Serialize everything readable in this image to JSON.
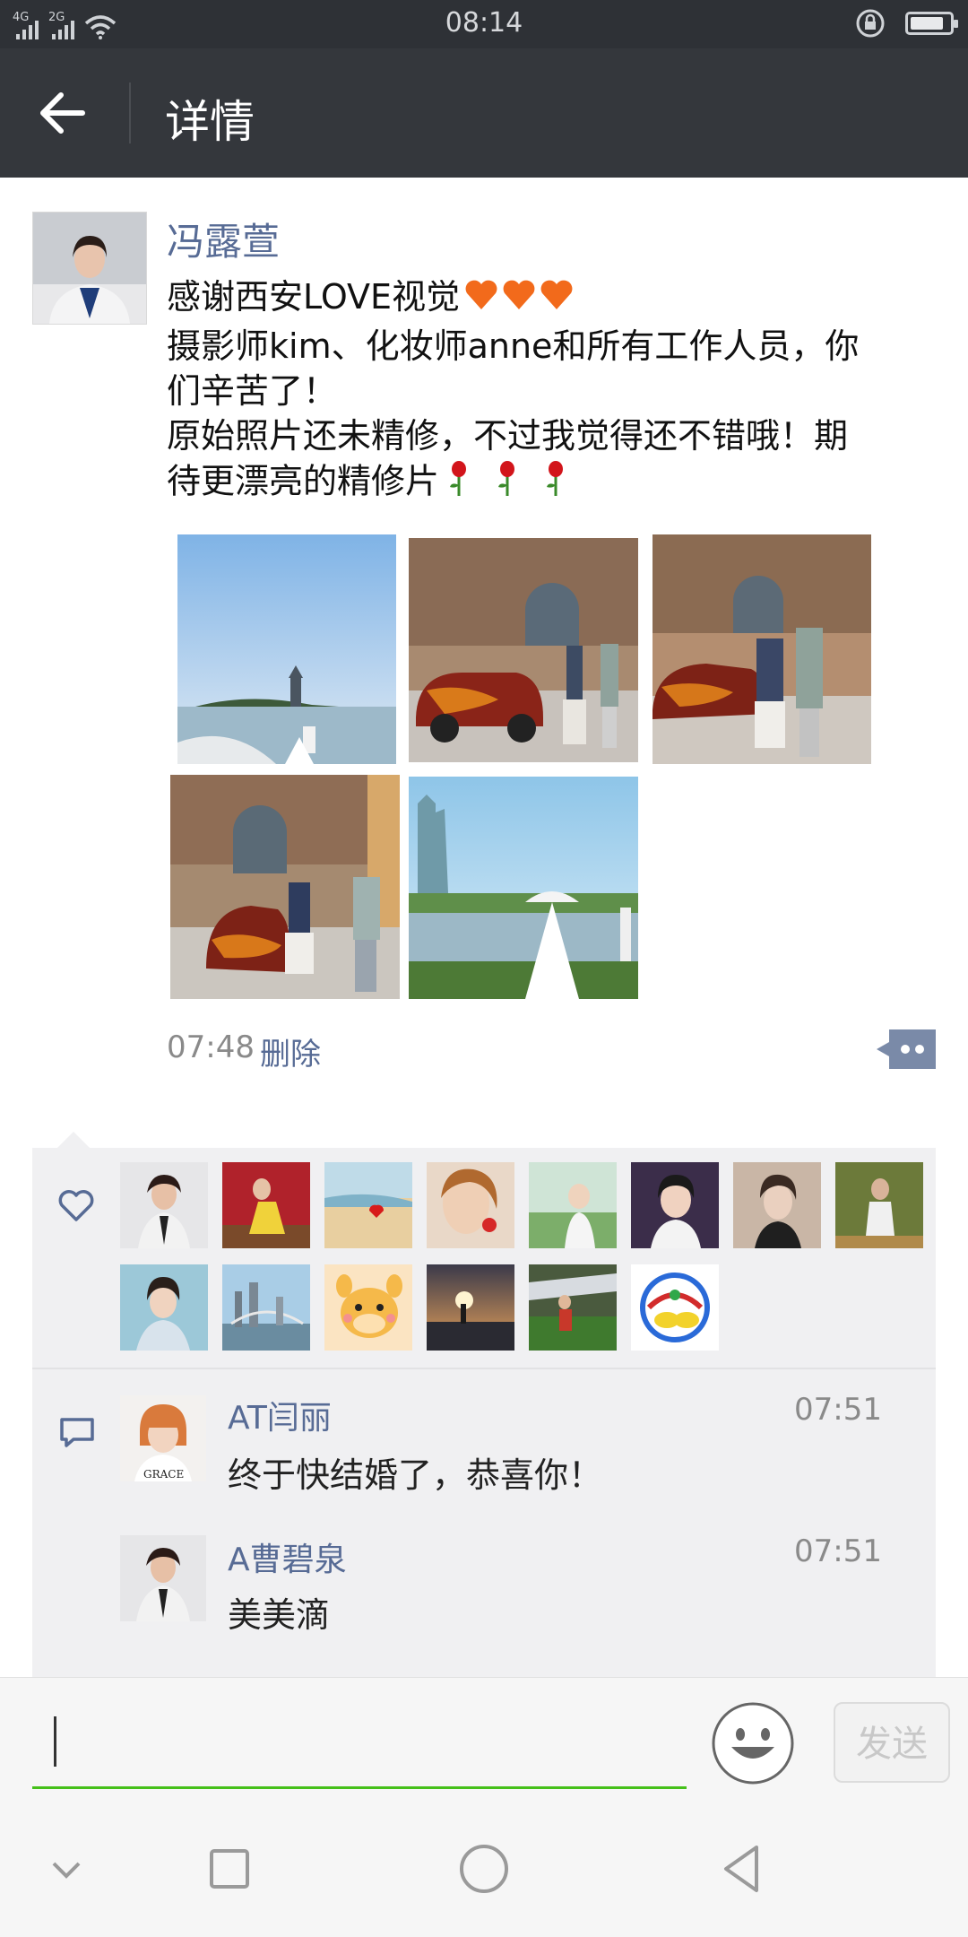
{
  "status_bar": {
    "time": "08:14",
    "net1": "4G",
    "net2": "2G",
    "battery_level": 0.85
  },
  "header": {
    "title": "详情"
  },
  "post": {
    "author": "冯露萱",
    "text_lines": [
      "感谢西安LOVE视觉",
      "摄影师kim、化妆师anne和所有工作人员，你",
      "们辛苦了！",
      "原始照片还未精修，不过我觉得还不错哦！期",
      "待更漂亮的精修片"
    ],
    "time": "07:48",
    "delete_label": "删除",
    "photo_count": 5
  },
  "likes": {
    "count": 14
  },
  "comments": [
    {
      "name": "AT闫丽",
      "time": "07:51",
      "text": "终于快结婚了，恭喜你！"
    },
    {
      "name": "A曹碧泉",
      "time": "07:51",
      "text": "美美滴"
    }
  ],
  "input": {
    "value": "",
    "send_label": "发送"
  },
  "colors": {
    "link": "#576b95",
    "header_bg": "#34373c",
    "status_bg": "#2e3136",
    "accent_green": "#45c01a"
  }
}
